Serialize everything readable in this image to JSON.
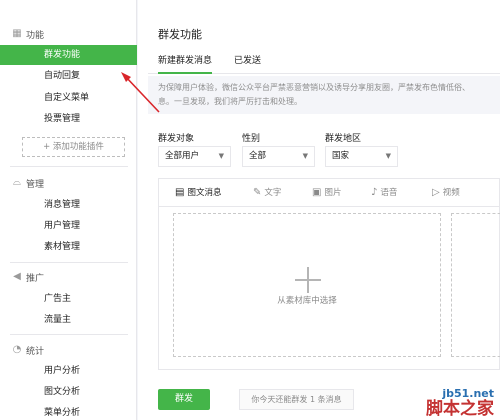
{
  "sidebar": {
    "sections": [
      {
        "label": "功能",
        "icon": "grid-icon",
        "items": [
          "群发功能",
          "自动回复",
          "自定义菜单",
          "投票管理"
        ]
      },
      {
        "label": "管理",
        "icon": "inbox-icon",
        "items": [
          "消息管理",
          "用户管理",
          "素材管理"
        ]
      },
      {
        "label": "推广",
        "icon": "megaphone-icon",
        "items": [
          "广告主",
          "流量主"
        ]
      },
      {
        "label": "统计",
        "icon": "pie-chart-icon",
        "items": [
          "用户分析",
          "图文分析",
          "菜单分析"
        ]
      }
    ],
    "active_item": "群发功能",
    "add_plugin": "+ 添加功能插件"
  },
  "main": {
    "title": "群发功能",
    "tabs": [
      "新建群发消息",
      "已发送"
    ],
    "notice_line1": "为保障用户体验，微信公众平台严禁恶意营销以及诱导分享朋友圈，严禁发布色情低俗、",
    "notice_line2": "息。一旦发现，我们将严厉打击和处理。",
    "filters": [
      {
        "label": "群发对象",
        "value": "全部用户"
      },
      {
        "label": "性别",
        "value": "全部"
      },
      {
        "label": "群发地区",
        "value": "国家"
      }
    ],
    "editor_tools": [
      {
        "label": "图文消息",
        "icon": "news-icon"
      },
      {
        "label": "文字",
        "icon": "pen-icon"
      },
      {
        "label": "图片",
        "icon": "image-icon"
      },
      {
        "label": "语音",
        "icon": "mic-icon"
      },
      {
        "label": "视频",
        "icon": "video-icon"
      }
    ],
    "drop_text": "从素材库中选择",
    "send_button": "群发",
    "quota_text": "你今天还能群发 1 条消息"
  },
  "watermark": {
    "url": "jb51.net",
    "name": "脚本之家"
  },
  "colors": {
    "accent": "#44b549",
    "annotation": "#d9252a"
  }
}
